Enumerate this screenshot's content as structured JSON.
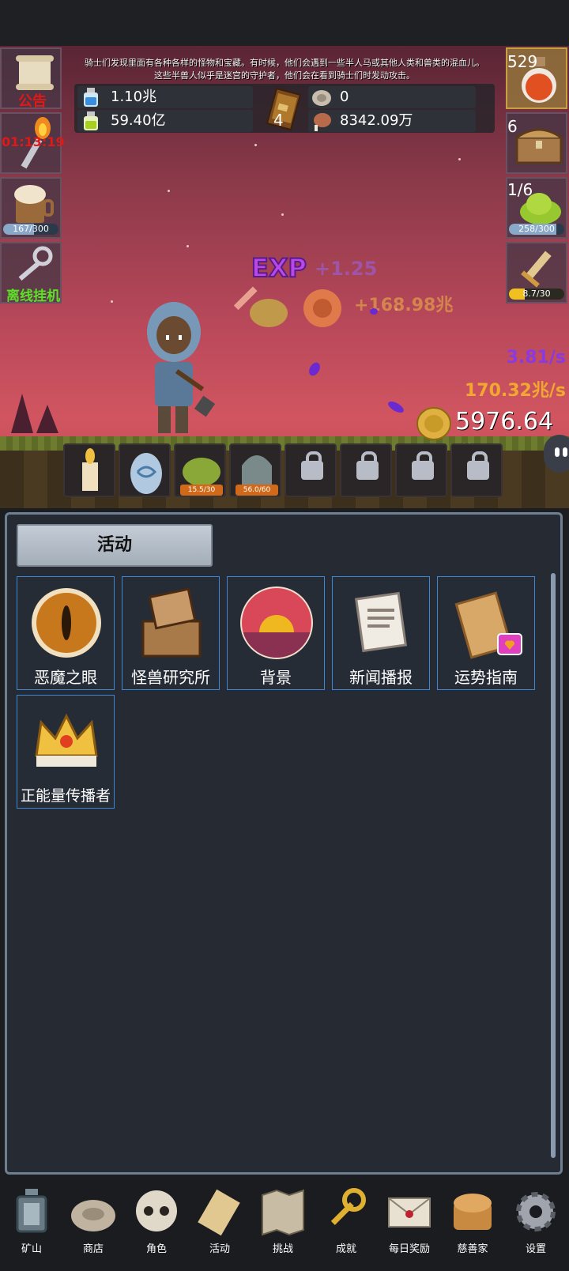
{
  "notice": {
    "line1": "骑士们发现里面有各种各样的怪物和宝藏。有时候，他们会遇到一些半人马或其他人类和兽类的混血儿。",
    "line2": "这些半兽人似乎是迷宫的守护者，他们会在看到骑士们时发动攻击。"
  },
  "resources": {
    "blue_potion": "1.10兆",
    "green_potion": "59.40亿",
    "book_count": "4",
    "stone": "0",
    "meat": "8342.09万"
  },
  "left_slots": {
    "announcement": "公告",
    "torch_timer": "01:13:19",
    "beer_progress": "167/300",
    "offline": "离线挂机"
  },
  "right_slots": {
    "potion_count": "529",
    "chest_count": "6",
    "slime_count": "1/6",
    "slime_progress": "258/300",
    "sword_progress": "8.7/30"
  },
  "scene": {
    "exp_label": "EXP",
    "exp_gain": "+1.25",
    "gold_gain": "+168.98兆",
    "rate_purple": "3.81/s",
    "rate_gold": "170.32兆/s",
    "gold_total": "5976.64兆"
  },
  "creatures": {
    "slime_tag": "15.5/30",
    "ghost_tag": "56.0/60"
  },
  "panel": {
    "title": "活动",
    "tiles": [
      {
        "label": "恶魔之眼",
        "icon": "demon-eye-icon"
      },
      {
        "label": "怪兽研究所",
        "icon": "monster-lab-icon"
      },
      {
        "label": "背景",
        "icon": "sunset-icon"
      },
      {
        "label": "新闻播报",
        "icon": "newspaper-icon"
      },
      {
        "label": "运势指南",
        "icon": "fortune-scroll-icon"
      },
      {
        "label": "正能量传播者",
        "icon": "crown-icon"
      }
    ]
  },
  "nav": [
    {
      "label": "矿山",
      "icon": "lantern-icon"
    },
    {
      "label": "商店",
      "icon": "rock-icon"
    },
    {
      "label": "角色",
      "icon": "skull-icon"
    },
    {
      "label": "活动",
      "icon": "scroll-icon"
    },
    {
      "label": "挑战",
      "icon": "map-icon"
    },
    {
      "label": "成就",
      "icon": "key-icon"
    },
    {
      "label": "每日奖励",
      "icon": "letter-icon"
    },
    {
      "label": "慈善家",
      "icon": "bread-icon"
    },
    {
      "label": "设置",
      "icon": "gear-icon"
    }
  ],
  "colors": {
    "tile_border": "#3c86d8",
    "panel_bg": "#252a33",
    "gold_text": "#f0a830",
    "purple_text": "#8a3ae0",
    "red_text": "#e01818",
    "green_text": "#5ce028"
  }
}
